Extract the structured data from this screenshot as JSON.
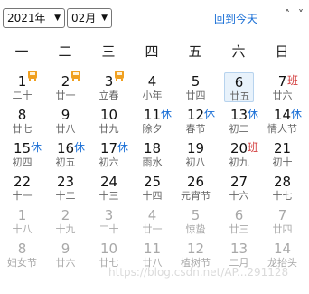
{
  "header": {
    "year_value": "2021年",
    "month_value": "02月",
    "today_label": "回到今天",
    "prev_symbol": "˄",
    "next_symbol": "˅"
  },
  "weekdays": [
    "一",
    "二",
    "三",
    "四",
    "五",
    "六",
    "日"
  ],
  "weeks": [
    [
      {
        "num": "1",
        "lunar": "二十",
        "marker": "tv-icon"
      },
      {
        "num": "2",
        "lunar": "廿一",
        "marker": "tv-icon"
      },
      {
        "num": "3",
        "lunar": "立春",
        "marker": "tv-icon"
      },
      {
        "num": "4",
        "lunar": "小年"
      },
      {
        "num": "5",
        "lunar": "廿四"
      },
      {
        "num": "6",
        "lunar": "廿五",
        "today": true
      },
      {
        "num": "7",
        "lunar": "廿六",
        "badge": "班",
        "badge_type": "work"
      }
    ],
    [
      {
        "num": "8",
        "lunar": "廿七"
      },
      {
        "num": "9",
        "lunar": "廿八"
      },
      {
        "num": "10",
        "lunar": "廿九"
      },
      {
        "num": "11",
        "lunar": "除夕",
        "badge": "休",
        "badge_type": "rest"
      },
      {
        "num": "12",
        "lunar": "春节",
        "badge": "休",
        "badge_type": "rest"
      },
      {
        "num": "13",
        "lunar": "初二",
        "badge": "休",
        "badge_type": "rest"
      },
      {
        "num": "14",
        "lunar": "情人节",
        "badge": "休",
        "badge_type": "rest"
      }
    ],
    [
      {
        "num": "15",
        "lunar": "初四",
        "badge": "休",
        "badge_type": "rest"
      },
      {
        "num": "16",
        "lunar": "初五",
        "badge": "休",
        "badge_type": "rest"
      },
      {
        "num": "17",
        "lunar": "初六",
        "badge": "休",
        "badge_type": "rest"
      },
      {
        "num": "18",
        "lunar": "雨水"
      },
      {
        "num": "19",
        "lunar": "初八"
      },
      {
        "num": "20",
        "lunar": "初九",
        "badge": "班",
        "badge_type": "work"
      },
      {
        "num": "21",
        "lunar": "初十"
      }
    ],
    [
      {
        "num": "22",
        "lunar": "十一"
      },
      {
        "num": "23",
        "lunar": "十二"
      },
      {
        "num": "24",
        "lunar": "十三"
      },
      {
        "num": "25",
        "lunar": "十四"
      },
      {
        "num": "26",
        "lunar": "元宵节"
      },
      {
        "num": "27",
        "lunar": "十六"
      },
      {
        "num": "28",
        "lunar": "十七"
      }
    ],
    [
      {
        "num": "1",
        "lunar": "十八",
        "other": true
      },
      {
        "num": "2",
        "lunar": "十九",
        "other": true
      },
      {
        "num": "3",
        "lunar": "二十",
        "other": true
      },
      {
        "num": "4",
        "lunar": "廿一",
        "other": true
      },
      {
        "num": "5",
        "lunar": "惊蛰",
        "other": true
      },
      {
        "num": "6",
        "lunar": "廿三",
        "other": true
      },
      {
        "num": "7",
        "lunar": "廿四",
        "other": true
      }
    ],
    [
      {
        "num": "8",
        "lunar": "妇女节",
        "other": true
      },
      {
        "num": "9",
        "lunar": "廿六",
        "other": true
      },
      {
        "num": "10",
        "lunar": "廿七",
        "other": true
      },
      {
        "num": "11",
        "lunar": "廿八",
        "other": true
      },
      {
        "num": "12",
        "lunar": "植树节",
        "other": true
      },
      {
        "num": "13",
        "lunar": "二月",
        "other": true
      },
      {
        "num": "14",
        "lunar": "龙抬头",
        "other": true
      }
    ]
  ],
  "watermark": "https://blog.csdn.net/AP...291128",
  "colors": {
    "accent": "#1a6fd6",
    "work_badge": "#d23a3a",
    "today_bg": "#e8f2fb",
    "tv_icon": "#f0a020"
  }
}
